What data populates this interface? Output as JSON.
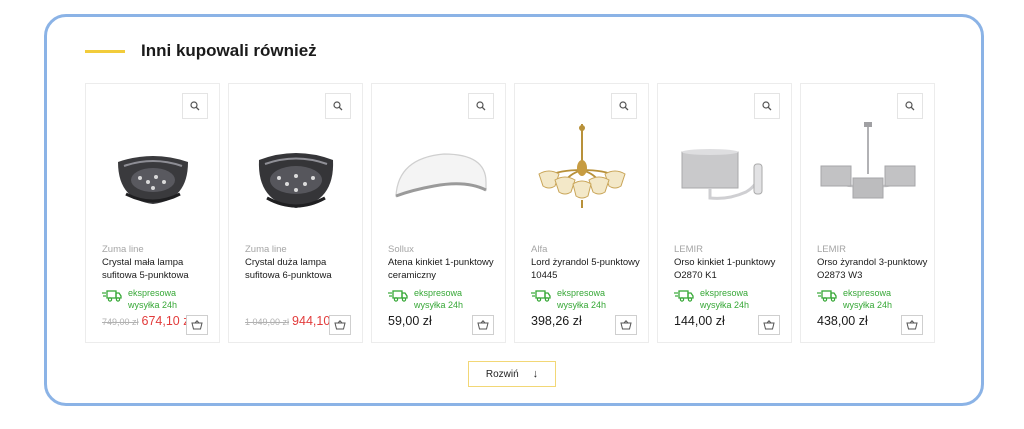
{
  "section": {
    "title": "Inni kupowali również"
  },
  "products": [
    {
      "brand": "Zuma line",
      "name": "Crystal mała lampa sufitowa 5-punktowa",
      "delivery": "ekspresowa wysyłka 24h",
      "old_price": "749,00 zł",
      "price": "674,10 zł",
      "sale": true
    },
    {
      "brand": "Zuma line",
      "name": "Crystal duża lampa sufitowa 6-punktowa",
      "delivery": "",
      "old_price": "1 049,00 zł",
      "price": "944,10",
      "sale": true
    },
    {
      "brand": "Sollux",
      "name": "Atena kinkiet 1-punktowy ceramiczny",
      "delivery": "ekspresowa wysyłka 24h",
      "old_price": "",
      "price": "59,00 zł",
      "sale": false
    },
    {
      "brand": "Alfa",
      "name": "Lord żyrandol 5-punktowy 10445",
      "delivery": "ekspresowa wysyłka 24h",
      "old_price": "",
      "price": "398,26 zł",
      "sale": false
    },
    {
      "brand": "LEMIR",
      "name": "Orso kinkiet 1-punktowy O2870 K1",
      "delivery": "ekspresowa wysyłka 24h",
      "old_price": "",
      "price": "144,00 zł",
      "sale": false
    },
    {
      "brand": "LEMIR",
      "name": "Orso żyrandol 3-punktowy O2873 W3",
      "delivery": "ekspresowa wysyłka 24h",
      "old_price": "",
      "price": "438,00 zł",
      "sale": false
    }
  ],
  "icons": {
    "zoom": "magnifier-icon",
    "delivery": "truck-icon",
    "cart": "basket-icon"
  },
  "expand_button": {
    "label": "Rozwiń",
    "arrow": "↓"
  },
  "colors": {
    "accent": "#f2cc3b",
    "sale": "#e23b3b",
    "delivery": "#37a837",
    "frame": "#8bb3e6"
  }
}
